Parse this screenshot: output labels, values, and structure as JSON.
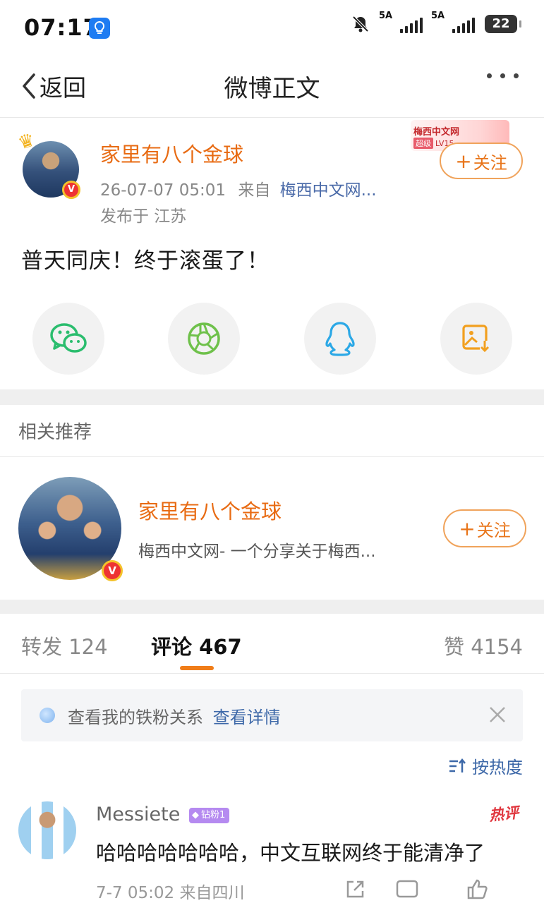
{
  "status_bar": {
    "time": "07:17",
    "sim1_label": "5A",
    "sim2_label": "5A",
    "battery": "22",
    "icons": [
      "tips-app-icon",
      "mute-bell-icon",
      "signal-icon",
      "battery-icon"
    ]
  },
  "nav": {
    "back_label": "返回",
    "title": "微博正文"
  },
  "post": {
    "author": "家里有八个金球",
    "datetime": "26-07-07 05:01",
    "source_prefix": "来自",
    "source": "梅西中文网...",
    "location": "发布于 江苏",
    "fan_badge_title": "梅西中文网",
    "fan_badge_tag": "超级",
    "fan_badge_level": "LV15",
    "follow_label": "关注",
    "text": "普天同庆！终于滚蛋了！"
  },
  "share": {
    "items": [
      "wechat-icon",
      "moments-icon",
      "qq-icon",
      "save-image-icon"
    ]
  },
  "recommend": {
    "section_label": "相关推荐",
    "name": "家里有八个金球",
    "desc": "梅西中文网- 一个分享关于梅西...",
    "follow_label": "关注"
  },
  "tabs": {
    "repost_label": "转发",
    "repost_count": "124",
    "comment_label": "评论",
    "comment_count": "467",
    "like_label": "赞",
    "like_count": "4154"
  },
  "notice": {
    "text": "查看我的铁粉关系",
    "link": "查看详情"
  },
  "sort": {
    "label": "按热度"
  },
  "comment": {
    "user": "Messiete",
    "badge": "钻粉1",
    "hot_tag": "热评",
    "text": "哈哈哈哈哈哈哈，中文互联网终于能清净了",
    "meta": "7-7 05:02 来自四川"
  },
  "colors": {
    "accent_orange": "#e86b13",
    "link_blue": "#3d68a8",
    "verify_red": "#e33333"
  }
}
